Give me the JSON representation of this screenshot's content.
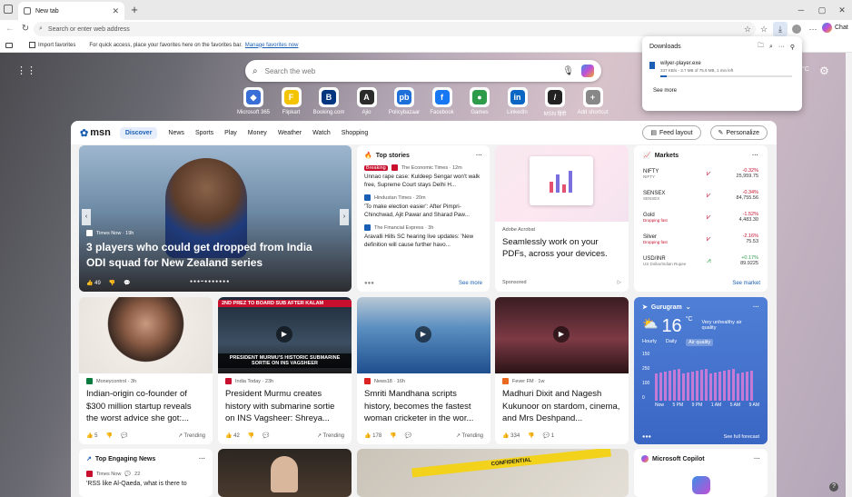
{
  "browser": {
    "tab_title": "New tab",
    "address_placeholder": "Search or enter web address",
    "copilot_label": "Chat",
    "favbar": {
      "import_label": "Import favorites",
      "hint_text": "For quick access, place your favorites here on the favorites bar.",
      "manage_link": "Manage favorites now"
    }
  },
  "downloads": {
    "title": "Downloads",
    "file_name": "wilyer-player.exe",
    "progress_text": "337 KB/s - 3.7 MB of 75.9 MB, 1 min left",
    "progress_fraction": 0.05,
    "see_more": "See more"
  },
  "newtab": {
    "search_placeholder": "Search the web",
    "shortcuts": [
      {
        "label": "Microsoft 365",
        "glyph": "◆",
        "color": "#3b6fd8"
      },
      {
        "label": "Flipkart",
        "glyph": "F",
        "color": "#f5c400"
      },
      {
        "label": "Booking.com",
        "glyph": "B",
        "color": "#003580"
      },
      {
        "label": "Ajio",
        "glyph": "A",
        "color": "#2b2b2b"
      },
      {
        "label": "Policybazaar",
        "glyph": "pb",
        "color": "#1e6fd9"
      },
      {
        "label": "Facebook",
        "glyph": "f",
        "color": "#1877f2"
      },
      {
        "label": "Games",
        "glyph": "●",
        "color": "#2e9b4a"
      },
      {
        "label": "LinkedIn",
        "glyph": "in",
        "color": "#0a66c2"
      },
      {
        "label": "MSN हिंदी",
        "glyph": "/",
        "color": "#222"
      },
      {
        "label": "Add shortcut",
        "glyph": "+",
        "color": "#888"
      }
    ]
  },
  "feed": {
    "logo": "msn",
    "nav": [
      "Discover",
      "News",
      "Sports",
      "Play",
      "Money",
      "Weather",
      "Watch",
      "Shopping"
    ],
    "feed_layout": "Feed layout",
    "personalize": "Personalize",
    "hero": {
      "source": "Times Now · 19h",
      "title": "3 players who could get dropped from India ODI squad for New Zealand series",
      "likes": "49"
    },
    "top_stories": {
      "heading": "Top stories",
      "items": [
        {
          "badge": "Breaking",
          "source": "The Economic Times · 12m",
          "title": "Unnao rape case: Kuldeep Sengar won't walk free, Supreme Court stays Delhi H..."
        },
        {
          "badge": "",
          "source": "Hindustan Times · 20m",
          "title": "'To make election easier': After Pimpri-Chinchwad, Ajit Pawar and Sharad Paw..."
        },
        {
          "badge": "",
          "source": "The Financial Express · 3h",
          "title": "Aravalli Hills SC hearing live updates: 'New definition will cause further havo..."
        }
      ],
      "see_more": "See more"
    },
    "ad": {
      "source": "Adobe Acrobat",
      "title": "Seamlessly work on your PDFs, across your devices.",
      "sponsored": "Sponsored"
    },
    "markets": {
      "heading": "Markets",
      "rows": [
        {
          "name": "NIFTY",
          "sub": "NIFTY",
          "change": "-0.32%",
          "value": "25,959.75",
          "up": false
        },
        {
          "name": "SENSEX",
          "sub": "SENSEX",
          "change": "-0.34%",
          "value": "84,755.56",
          "up": false
        },
        {
          "name": "Gold",
          "sub": "Dropping fast",
          "change": "-1.52%",
          "value": "4,483.30",
          "up": false
        },
        {
          "name": "Silver",
          "sub": "Dropping fast",
          "change": "-2.16%",
          "value": "75.53",
          "up": false
        },
        {
          "name": "USD/INR",
          "sub": "US Dollar/Indian Rupee",
          "change": "+0.17%",
          "value": "89.9225",
          "up": true
        }
      ],
      "see_more": "See market"
    },
    "cards": [
      {
        "source": "Moneycontrol · 3h",
        "title": "Indian-origin co-founder of $300 million startup reveals the worst advice she got:...",
        "likes": "5",
        "trending": "Trending",
        "src_color": "#0b7a3e"
      },
      {
        "source": "India Today · 23h",
        "title": "President Murmu creates history with submarine sortie on INS Vagsheer: Shreya...",
        "likes": "42",
        "trending": "Trending",
        "src_color": "#c8102e",
        "overlay_top": "2ND PREZ TO BOARD SUB AFTER KALAM",
        "overlay_bottom": "PRESIDENT MURMU'S HISTORIC SUBMARINE SORTIE ON INS VAGSHEER"
      },
      {
        "source": "News18 · 16h",
        "title": "Smriti Mandhana scripts history, becomes the fastest woman cricketer in the wor...",
        "likes": "178",
        "trending": "Trending",
        "src_color": "#d22"
      },
      {
        "source": "Fever FM · 1w",
        "title": "Madhuri Dixit and Nagesh Kukunoor on stardom, cinema, and Mrs Deshpand...",
        "likes": "334",
        "comments": "1",
        "src_color": "#e96a1f"
      }
    ],
    "weather": {
      "location": "Gurugram",
      "temp": "16",
      "unit": "°C",
      "condition": "Very unhealthy air quality",
      "tabs": [
        "Hourly",
        "Daily",
        "Air quality"
      ],
      "y_ticks": [
        "150",
        "250",
        "100",
        "0"
      ],
      "x_ticks": [
        "Now",
        "5 PM",
        "9 PM",
        "1 AM",
        "5 AM",
        "9 AM"
      ],
      "see_full": "See full forecast"
    },
    "engaging": {
      "heading": "Top Engaging News",
      "source": "Times Now",
      "comments": "22",
      "title": "'RSS like Al-Qaeda, what is there to"
    },
    "copilot": {
      "heading": "Microsoft Copilot"
    },
    "tape_text": "CONFIDENTIAL"
  }
}
